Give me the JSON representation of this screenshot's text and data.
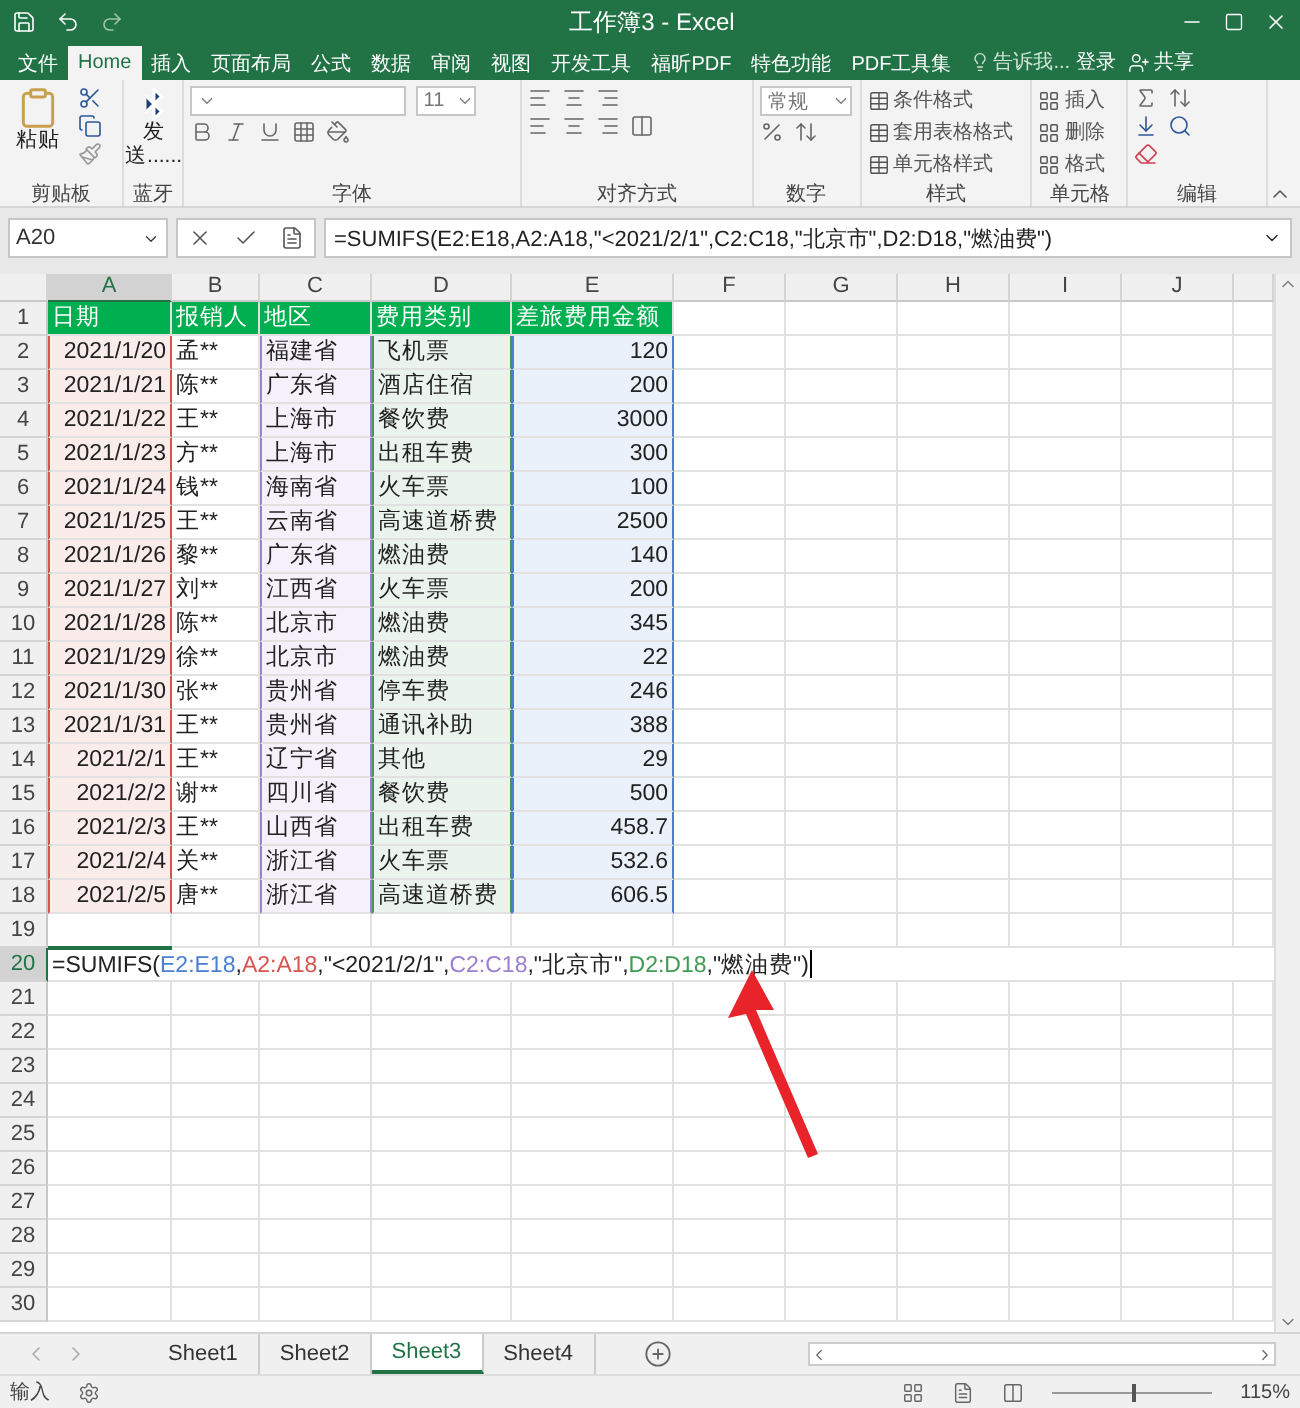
{
  "title_bar": {
    "title": "工作簿3 - Excel"
  },
  "ribbon_tabs": [
    {
      "label": "文件",
      "selected": false
    },
    {
      "label": "Home",
      "selected": true
    },
    {
      "label": "插入",
      "selected": false
    },
    {
      "label": "页面布局",
      "selected": false
    },
    {
      "label": "公式",
      "selected": false
    },
    {
      "label": "数据",
      "selected": false
    },
    {
      "label": "审阅",
      "selected": false
    },
    {
      "label": "视图",
      "selected": false
    },
    {
      "label": "开发工具",
      "selected": false
    },
    {
      "label": "福昕PDF",
      "selected": false
    },
    {
      "label": "特色功能",
      "selected": false
    },
    {
      "label": "PDF工具集",
      "selected": false
    }
  ],
  "tell_me": {
    "placeholder": "告诉我..."
  },
  "account": {
    "login": "登录",
    "share": "共享"
  },
  "ribbon": {
    "clipboard": {
      "paste": "粘贴",
      "label": "剪贴板"
    },
    "bluetooth": {
      "send": "发送......",
      "label": "蓝牙"
    },
    "font": {
      "size": "11",
      "label": "字体"
    },
    "alignment": {
      "label": "对齐方式"
    },
    "number": {
      "format": "常规",
      "label": "数字"
    },
    "styles": {
      "buttons": [
        "条件格式",
        "套用表格格式",
        "单元格样式"
      ],
      "label": "样式"
    },
    "cells": {
      "buttons": [
        "插入",
        "删除",
        "格式"
      ],
      "label": "单元格"
    },
    "editing": {
      "label": "编辑"
    }
  },
  "formula_bar": {
    "name_box": "A20",
    "formula": "=SUMIFS(E2:E18,A2:A18,\"<2021/2/1\",C2:C18,\"北京市\",D2:D18,\"燃油费\")"
  },
  "columns": [
    {
      "label": "A",
      "selected": true,
      "color": "#d9534f"
    },
    {
      "label": "B",
      "selected": false
    },
    {
      "label": "C",
      "selected": false,
      "color": "#9b7fd0"
    },
    {
      "label": "D",
      "selected": false,
      "color": "#3f9b52"
    },
    {
      "label": "E",
      "selected": false,
      "color": "#4a7fd4"
    },
    {
      "label": "F",
      "selected": false
    },
    {
      "label": "G",
      "selected": false
    },
    {
      "label": "H",
      "selected": false
    },
    {
      "label": "I",
      "selected": false
    },
    {
      "label": "J",
      "selected": false
    }
  ],
  "rows": [
    {
      "number": "1",
      "selected": false,
      "kind": "header",
      "cells": [
        "日期",
        "报销人",
        "地区",
        "费用类别",
        "差旅费用金额"
      ]
    },
    {
      "number": "2",
      "selected": false,
      "kind": "data",
      "cells": [
        "2021/1/20",
        "孟**",
        "福建省",
        "飞机票",
        "120"
      ]
    },
    {
      "number": "3",
      "selected": false,
      "kind": "data",
      "cells": [
        "2021/1/21",
        "陈**",
        "广东省",
        "酒店住宿",
        "200"
      ]
    },
    {
      "number": "4",
      "selected": false,
      "kind": "data",
      "cells": [
        "2021/1/22",
        "王**",
        "上海市",
        "餐饮费",
        "3000"
      ]
    },
    {
      "number": "5",
      "selected": false,
      "kind": "data",
      "cells": [
        "2021/1/23",
        "方**",
        "上海市",
        "出租车费",
        "300"
      ]
    },
    {
      "number": "6",
      "selected": false,
      "kind": "data",
      "cells": [
        "2021/1/24",
        "钱**",
        "海南省",
        "火车票",
        "100"
      ]
    },
    {
      "number": "7",
      "selected": false,
      "kind": "data",
      "cells": [
        "2021/1/25",
        "王**",
        "云南省",
        "高速道桥费",
        "2500"
      ]
    },
    {
      "number": "8",
      "selected": false,
      "kind": "data",
      "cells": [
        "2021/1/26",
        "黎**",
        "广东省",
        "燃油费",
        "140"
      ]
    },
    {
      "number": "9",
      "selected": false,
      "kind": "data",
      "cells": [
        "2021/1/27",
        "刘**",
        "江西省",
        "火车票",
        "200"
      ]
    },
    {
      "number": "10",
      "selected": false,
      "kind": "data",
      "cells": [
        "2021/1/28",
        "陈**",
        "北京市",
        "燃油费",
        "345"
      ]
    },
    {
      "number": "11",
      "selected": false,
      "kind": "data",
      "cells": [
        "2021/1/29",
        "徐**",
        "北京市",
        "燃油费",
        "22"
      ]
    },
    {
      "number": "12",
      "selected": false,
      "kind": "data",
      "cells": [
        "2021/1/30",
        "张**",
        "贵州省",
        "停车费",
        "246"
      ]
    },
    {
      "number": "13",
      "selected": false,
      "kind": "data",
      "cells": [
        "2021/1/31",
        "王**",
        "贵州省",
        "通讯补助",
        "388"
      ]
    },
    {
      "number": "14",
      "selected": false,
      "kind": "data",
      "cells": [
        "2021/2/1",
        "王**",
        "辽宁省",
        "其他",
        "29"
      ]
    },
    {
      "number": "15",
      "selected": false,
      "kind": "data",
      "cells": [
        "2021/2/2",
        "谢**",
        "四川省",
        "餐饮费",
        "500"
      ]
    },
    {
      "number": "16",
      "selected": false,
      "kind": "data",
      "cells": [
        "2021/2/3",
        "王**",
        "山西省",
        "出租车费",
        "458.7"
      ]
    },
    {
      "number": "17",
      "selected": false,
      "kind": "data",
      "cells": [
        "2021/2/4",
        "关**",
        "浙江省",
        "火车票",
        "532.6"
      ]
    },
    {
      "number": "18",
      "selected": false,
      "kind": "data",
      "cells": [
        "2021/2/5",
        "唐**",
        "浙江省",
        "高速道桥费",
        "606.5"
      ]
    },
    {
      "number": "19",
      "selected": false,
      "kind": "empty"
    },
    {
      "number": "20",
      "selected": true,
      "kind": "formula",
      "segments": [
        {
          "text": "=SUMIFS("
        },
        {
          "text": "E2:E18",
          "color": "#4a7fd4"
        },
        {
          "text": ","
        },
        {
          "text": "A2:A18",
          "color": "#d9534f"
        },
        {
          "text": ",\"<2021/2/1\","
        },
        {
          "text": "C2:C18",
          "color": "#9b7fd0"
        },
        {
          "text": ",\"北京市\","
        },
        {
          "text": "D2:D18",
          "color": "#3f9b52"
        },
        {
          "text": ",\"燃油费\")"
        }
      ]
    },
    {
      "number": "21",
      "selected": false,
      "kind": "empty"
    },
    {
      "number": "22",
      "selected": false,
      "kind": "empty"
    },
    {
      "number": "23",
      "selected": false,
      "kind": "empty"
    },
    {
      "number": "24",
      "selected": false,
      "kind": "empty"
    },
    {
      "number": "25",
      "selected": false,
      "kind": "empty"
    },
    {
      "number": "26",
      "selected": false,
      "kind": "empty"
    },
    {
      "number": "27",
      "selected": false,
      "kind": "empty"
    },
    {
      "number": "28",
      "selected": false,
      "kind": "empty"
    },
    {
      "number": "29",
      "selected": false,
      "kind": "empty"
    },
    {
      "number": "30",
      "selected": false,
      "kind": "empty"
    }
  ],
  "sheet_tabs": [
    {
      "label": "Sheet1",
      "selected": false
    },
    {
      "label": "Sheet2",
      "selected": false
    },
    {
      "label": "Sheet3",
      "selected": true
    },
    {
      "label": "Sheet4",
      "selected": false
    }
  ],
  "status_bar": {
    "mode": "输入",
    "zoom": "115%",
    "zoom_slider": {
      "level": 0.5
    }
  }
}
